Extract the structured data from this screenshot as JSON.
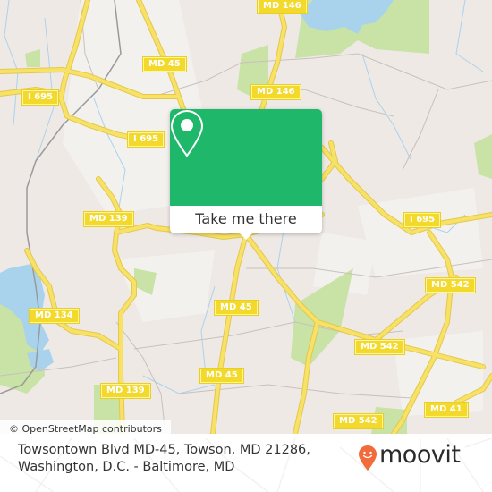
{
  "map": {
    "attribution": "© OpenStreetMap contributors",
    "road_labels": [
      {
        "id": "md146-top",
        "text": "MD 146"
      },
      {
        "id": "md45-north",
        "text": "MD 45"
      },
      {
        "id": "md146-mid",
        "text": "MD 146"
      },
      {
        "id": "i695-west",
        "text": "I 695"
      },
      {
        "id": "i695-center",
        "text": "I 695"
      },
      {
        "id": "i695-east",
        "text": "I 695"
      },
      {
        "id": "md139-north",
        "text": "MD 139"
      },
      {
        "id": "md45-center",
        "text": "MD 45"
      },
      {
        "id": "md542-east",
        "text": "MD 542"
      },
      {
        "id": "md134",
        "text": "MD 134"
      },
      {
        "id": "md542-center",
        "text": "MD 542"
      },
      {
        "id": "md45-south",
        "text": "MD 45"
      },
      {
        "id": "md139-south",
        "text": "MD 139"
      },
      {
        "id": "md542-south",
        "text": "MD 542"
      },
      {
        "id": "md41",
        "text": "MD 41"
      }
    ],
    "colors": {
      "land": "#efe9e6",
      "park": "#c9e2a6",
      "water": "#a9d3ec",
      "road_major": "#f7e267",
      "shield": "#f2d92c"
    }
  },
  "popup": {
    "icon": "location-pin-icon",
    "button_label": "Take me there",
    "color": "#1fb86a"
  },
  "footer": {
    "address_line1": "Towsontown Blvd MD-45, Towson, MD 21286,",
    "address_line2": "Washington, D.C. - Baltimore, MD",
    "brand": "moovit",
    "brand_color": "#f26b3a"
  }
}
